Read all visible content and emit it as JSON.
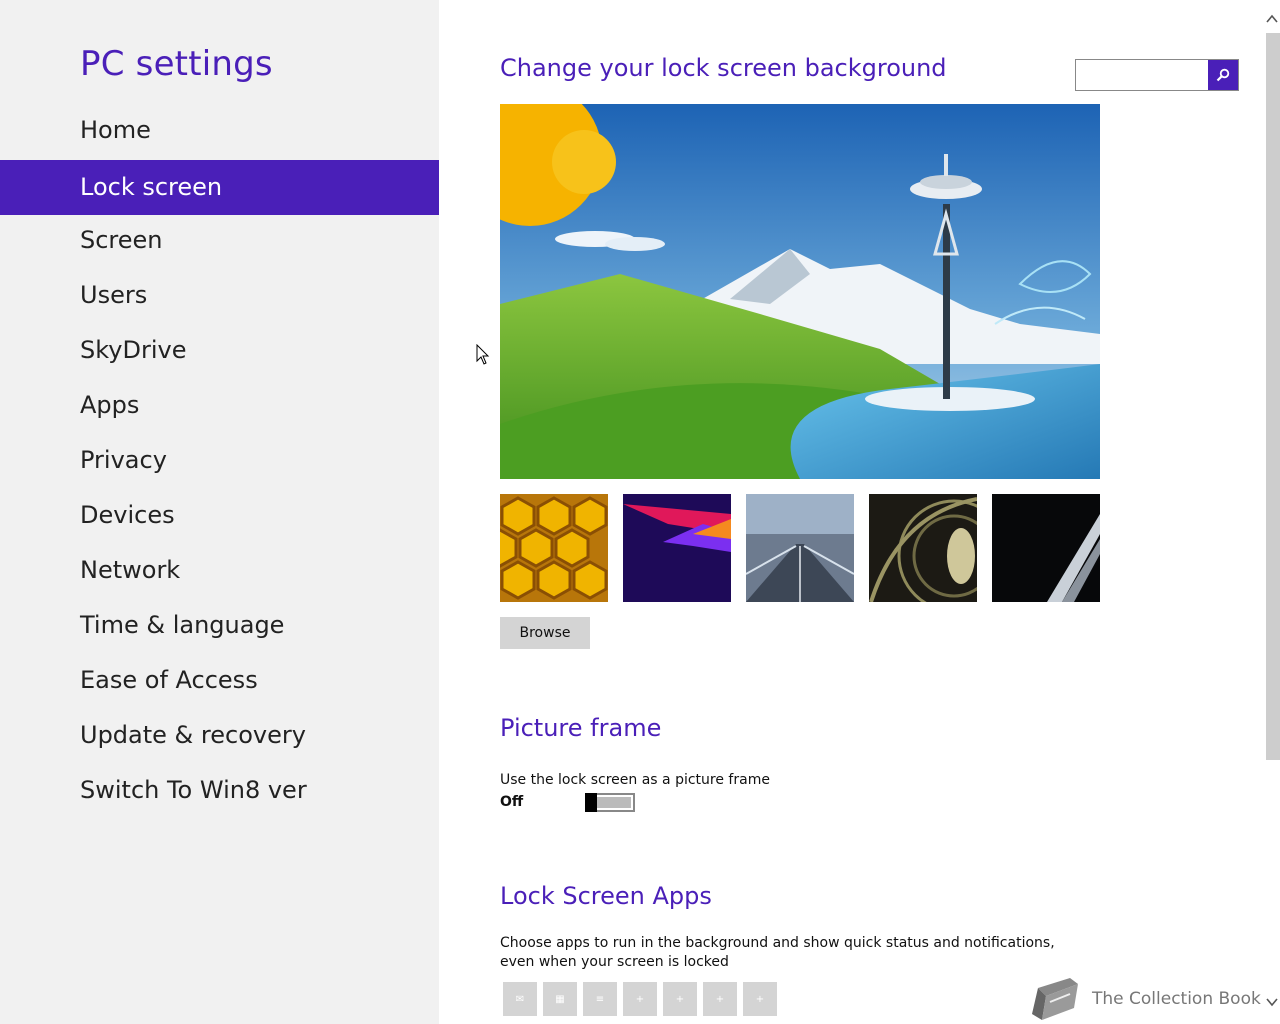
{
  "sidebar": {
    "title": "PC settings",
    "items": [
      {
        "label": "Home",
        "active": false
      },
      {
        "label": "Lock screen",
        "active": true
      },
      {
        "label": "Screen",
        "active": false
      },
      {
        "label": "Users",
        "active": false
      },
      {
        "label": "SkyDrive",
        "active": false
      },
      {
        "label": "Apps",
        "active": false
      },
      {
        "label": "Privacy",
        "active": false
      },
      {
        "label": "Devices",
        "active": false
      },
      {
        "label": "Network",
        "active": false
      },
      {
        "label": "Time & language",
        "active": false
      },
      {
        "label": "Ease of Access",
        "active": false
      },
      {
        "label": "Update & recovery",
        "active": false
      },
      {
        "label": "Switch To Win8 ver",
        "active": false
      }
    ]
  },
  "search": {
    "value": "",
    "placeholder": "",
    "icon": "search-icon"
  },
  "lock_background": {
    "title": "Change your lock screen background",
    "thumbnails": [
      "honeycomb",
      "purple-abstract",
      "highway-tunnel",
      "nautilus-shell",
      "piano-keys"
    ],
    "browse_label": "Browse"
  },
  "picture_frame": {
    "title": "Picture frame",
    "description": "Use the lock screen as a picture frame",
    "state_label": "Off",
    "enabled": false
  },
  "lock_apps": {
    "title": "Lock Screen Apps",
    "description": "Choose apps to run in the background and show quick status and notifications, even when your screen is locked",
    "slots": 7
  },
  "watermark": {
    "text": "The Collection Book",
    "icon": "book-icon"
  },
  "colors": {
    "accent": "#4a1fb8",
    "sidebar_bg": "#f1f1f1",
    "button_bg": "#d4d4d4"
  }
}
